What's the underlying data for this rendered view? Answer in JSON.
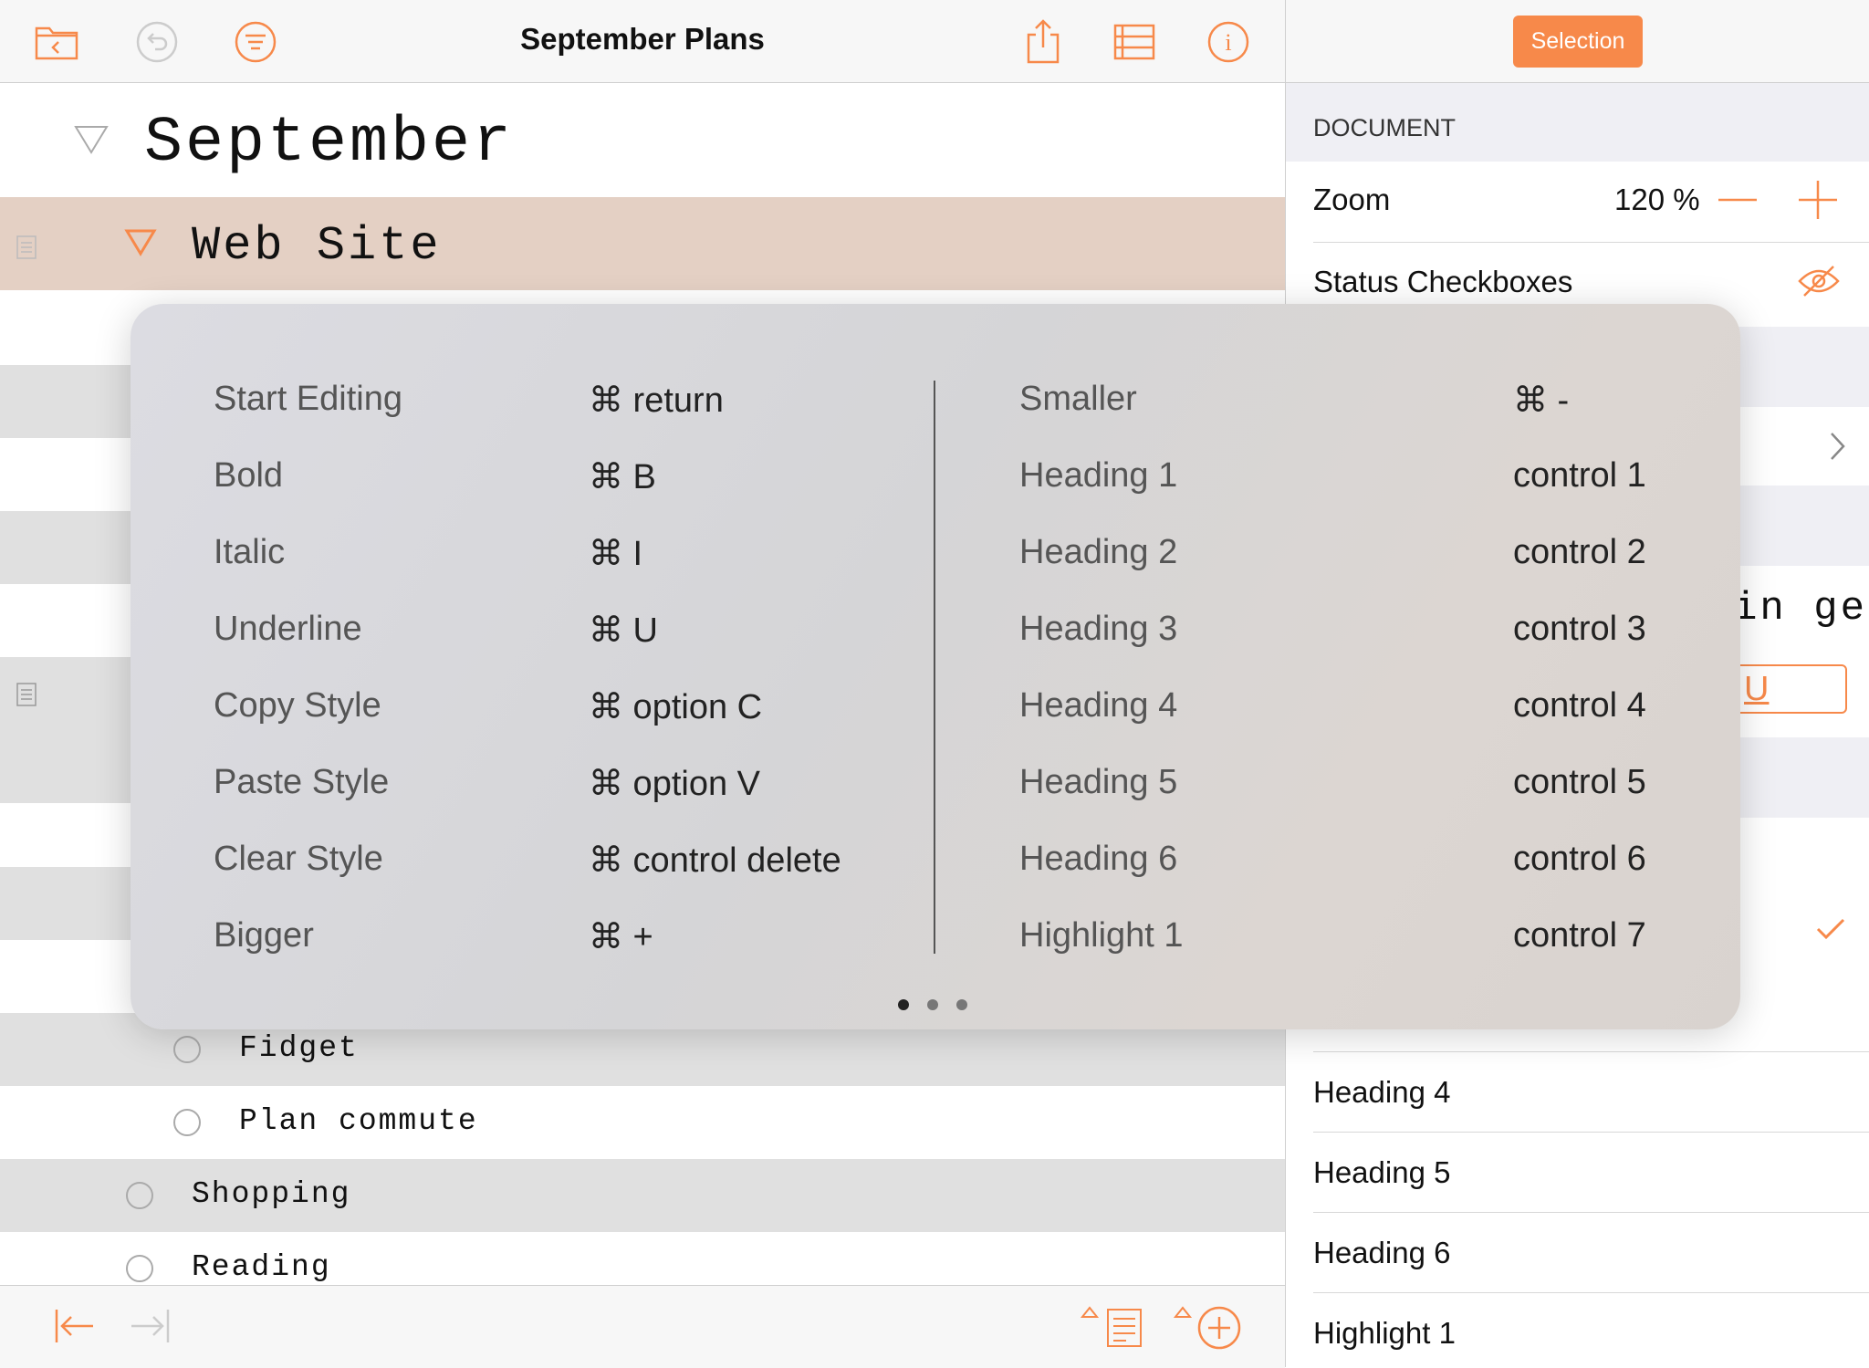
{
  "toolbar": {
    "title": "September Plans",
    "icons": [
      "folder-back-icon",
      "undo-icon",
      "filter-icon",
      "share-icon",
      "outline-view-icon",
      "info-icon"
    ]
  },
  "outline": {
    "heading": "September",
    "section": "Web Site",
    "items": [
      {
        "label": "Fidget",
        "grey": true
      },
      {
        "label": "Plan commute",
        "grey": false
      },
      {
        "label": "Shopping",
        "grey": true
      },
      {
        "label": "Reading",
        "grey": false
      }
    ]
  },
  "inspector": {
    "selection_label": "Selection",
    "section_title": "DOCUMENT",
    "zoom_label": "Zoom",
    "zoom_value": "120 %",
    "status_label": "Status Checkboxes",
    "partial_text": "in ge",
    "partial_underline": "U",
    "styles": [
      "Heading 4",
      "Heading 5",
      "Heading 6",
      "Highlight 1"
    ]
  },
  "shortcuts": {
    "left": [
      {
        "name": "Start Editing",
        "key": "⌘ return"
      },
      {
        "name": "Bold",
        "key": "⌘ B"
      },
      {
        "name": "Italic",
        "key": "⌘ I"
      },
      {
        "name": "Underline",
        "key": "⌘ U"
      },
      {
        "name": "Copy Style",
        "key": "⌘ option C"
      },
      {
        "name": "Paste Style",
        "key": "⌘ option V"
      },
      {
        "name": "Clear Style",
        "key": "⌘ control delete"
      },
      {
        "name": "Bigger",
        "key": "⌘ +"
      }
    ],
    "right": [
      {
        "name": "Smaller",
        "key": "⌘ -"
      },
      {
        "name": "Heading 1",
        "key": "control 1"
      },
      {
        "name": "Heading 2",
        "key": "control 2"
      },
      {
        "name": "Heading 3",
        "key": "control 3"
      },
      {
        "name": "Heading 4",
        "key": "control 4"
      },
      {
        "name": "Heading 5",
        "key": "control 5"
      },
      {
        "name": "Heading 6",
        "key": "control 6"
      },
      {
        "name": "Highlight 1",
        "key": "control 7"
      }
    ],
    "page_count": 3,
    "current_page": 1
  },
  "colors": {
    "accent": "#f7894a",
    "section_highlight": "#e4d0c4",
    "row_grey": "#e0e0e0"
  }
}
